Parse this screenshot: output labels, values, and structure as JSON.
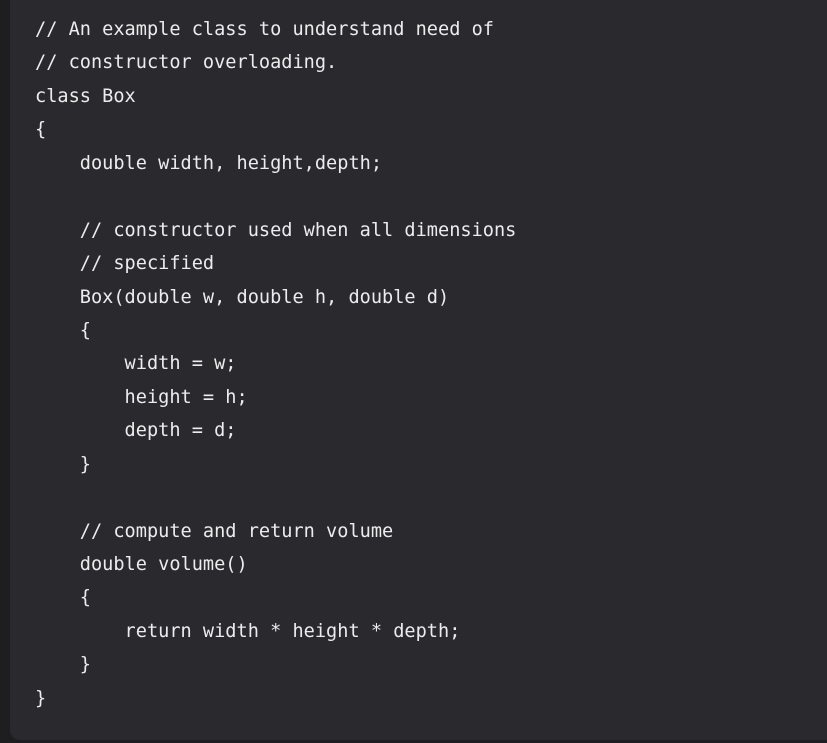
{
  "code_block": {
    "lines": [
      "// An example class to understand need of",
      "// constructor overloading.",
      "class Box",
      "{",
      "    double width, height,depth;",
      "",
      "    // constructor used when all dimensions",
      "    // specified",
      "    Box(double w, double h, double d)",
      "    {",
      "        width = w;",
      "        height = h;",
      "        depth = d;",
      "    }",
      "",
      "    // compute and return volume",
      "    double volume()",
      "    {",
      "        return width * height * depth;",
      "    }",
      "}"
    ]
  }
}
